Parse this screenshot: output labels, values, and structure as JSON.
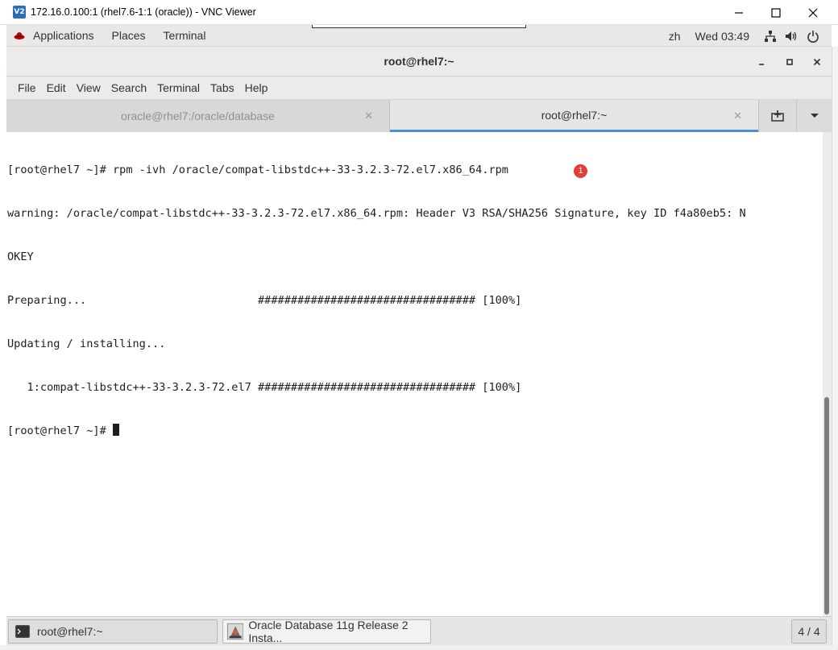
{
  "vnc": {
    "logo": "V2",
    "title": "172.16.0.100:1 (rhel7.6-1:1 (oracle)) - VNC Viewer"
  },
  "gnome_bar": {
    "applications": "Applications",
    "places": "Places",
    "terminal": "Terminal",
    "input_method": "zh",
    "clock": "Wed 03:49"
  },
  "terminal_window": {
    "title": "root@rhel7:~",
    "menu": [
      "File",
      "Edit",
      "View",
      "Search",
      "Terminal",
      "Tabs",
      "Help"
    ],
    "tabs": [
      {
        "label": "oracle@rhel7:/oracle/database",
        "active": false
      },
      {
        "label": "root@rhel7:~",
        "active": true
      }
    ],
    "lines": [
      "[root@rhel7 ~]# rpm -ivh /oracle/compat-libstdc++-33-3.2.3-72.el7.x86_64.rpm",
      "warning: /oracle/compat-libstdc++-33-3.2.3-72.el7.x86_64.rpm: Header V3 RSA/SHA256 Signature, key ID f4a80eb5: N",
      "OKEY",
      "Preparing...                          ################################# [100%]",
      "Updating / installing...",
      "   1:compat-libstdc++-33-3.2.3-72.el7 ################################# [100%]",
      "[root@rhel7 ~]# "
    ],
    "annotation_badge": "1"
  },
  "taskbar": {
    "items": [
      {
        "label": "root@rhel7:~",
        "icon": "terminal-icon"
      },
      {
        "label": "Oracle Database 11g Release 2 Insta...",
        "icon": "java-installer-icon"
      }
    ],
    "workspace": "4 / 4"
  },
  "colors": {
    "active_tab_underline": "#4a90d9",
    "badge": "#e43b3b",
    "vnc_logo": "#2a6ebb"
  }
}
